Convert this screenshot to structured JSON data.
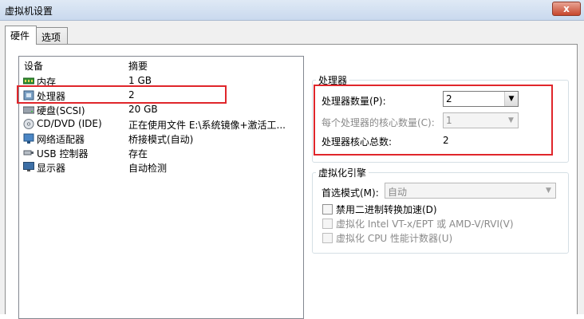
{
  "window": {
    "title": "虚拟机设置",
    "close_glyph": "x"
  },
  "tabs": [
    {
      "label": "硬件"
    },
    {
      "label": "选项"
    }
  ],
  "device_list": {
    "columns": {
      "device": "设备",
      "summary": "摘要"
    },
    "rows": [
      {
        "name": "内存",
        "summary": "1 GB",
        "icon": "memory-icon"
      },
      {
        "name": "处理器",
        "summary": "2",
        "icon": "processor-icon"
      },
      {
        "name": "硬盘(SCSI)",
        "summary": "20 GB",
        "icon": "hard-disk-icon"
      },
      {
        "name": "CD/DVD (IDE)",
        "summary": "正在使用文件 E:\\系统镜像+激活工...",
        "icon": "cd-dvd-icon"
      },
      {
        "name": "网络适配器",
        "summary": "桥接模式(自动)",
        "icon": "network-adapter-icon"
      },
      {
        "name": "USB 控制器",
        "summary": "存在",
        "icon": "usb-icon"
      },
      {
        "name": "显示器",
        "summary": "自动检测",
        "icon": "monitor-icon"
      }
    ]
  },
  "processor": {
    "group_label": "处理器",
    "count_label": "处理器数量(P):",
    "count_value": "2",
    "cores_label": "每个处理器的核心数量(C):",
    "cores_value": "1",
    "total_label": "处理器核心总数:",
    "total_value": "2"
  },
  "virtualization": {
    "group_label": "虚拟化引擎",
    "mode_label": "首选模式(M):",
    "mode_value": "自动",
    "opt1": "禁用二进制转换加速(D)",
    "opt2": "虚拟化 Intel VT-x/EPT 或 AMD-V/RVI(V)",
    "opt3": "虚拟化 CPU 性能计数器(U)"
  },
  "highlight_color": "#e0262b"
}
